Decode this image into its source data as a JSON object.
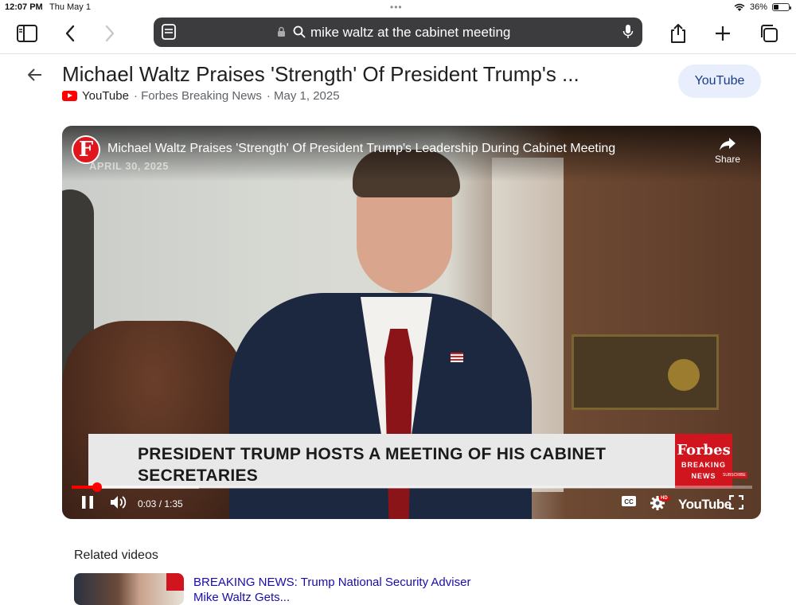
{
  "status_bar": {
    "time": "12:07 PM",
    "date": "Thu May 1",
    "battery_percent": "36%",
    "battery_level": 0.36
  },
  "address_bar": {
    "query": "mike waltz at the cabinet meeting"
  },
  "header": {
    "title": "Michael Waltz Praises 'Strength' Of President Trump's ...",
    "source": "YouTube",
    "channel": "· Forbes Breaking News",
    "date": "· May 1, 2025",
    "open_button": "YouTube"
  },
  "video": {
    "channel_logo_letter": "F",
    "title": "Michael Waltz Praises 'Strength' Of President Trump's Leadership During Cabinet Meeting",
    "overlay_date": "APRIL 30, 2025",
    "share_label": "Share",
    "lower_third": "PRESIDENT TRUMP HOSTS A MEETING OF HIS CABINET SECRETARIES",
    "forbes_logo": "Forbes",
    "forbes_sub1": "BREAKING",
    "forbes_sub2": "NEWS",
    "subscribe": "SUBSCRIBE",
    "time_display": "0:03 / 1:35",
    "progress_fraction": 0.038,
    "hd_badge": "HD",
    "youtube_wordmark": "YouTube"
  },
  "related": {
    "heading": "Related videos",
    "items": [
      {
        "title_line1": "BREAKING NEWS: Trump National Security Adviser",
        "title_line2": "Mike Waltz Gets..."
      }
    ]
  }
}
